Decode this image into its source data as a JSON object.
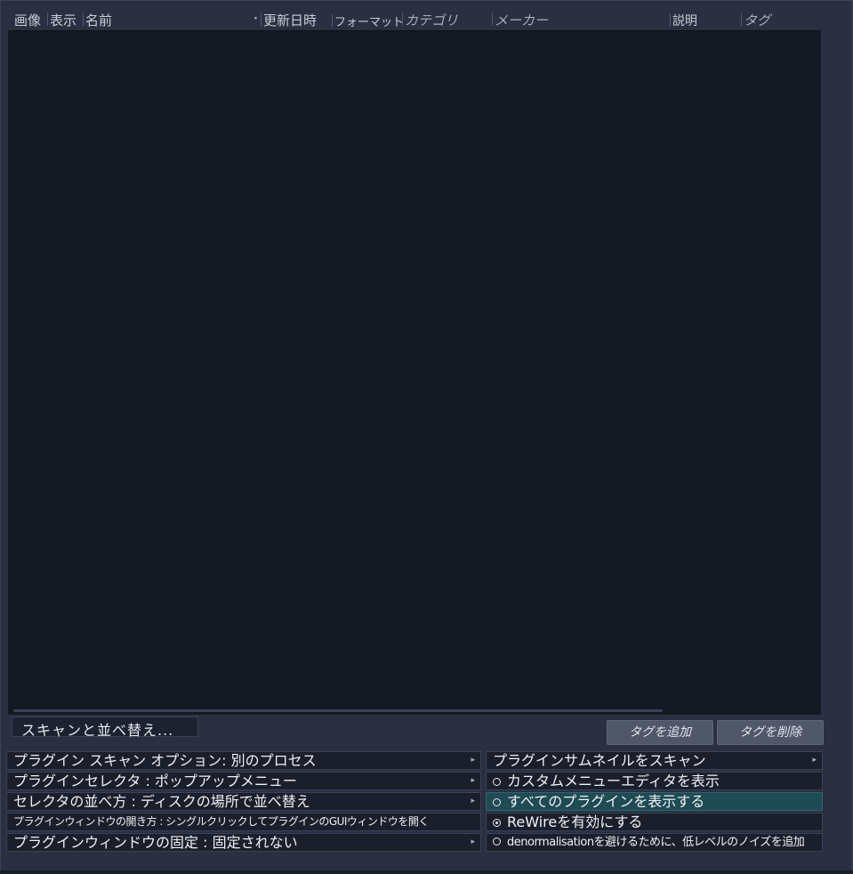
{
  "columns": [
    {
      "key": "image",
      "label": "画像"
    },
    {
      "key": "display",
      "label": "表示"
    },
    {
      "key": "name",
      "label": "名前"
    },
    {
      "key": "updated",
      "label": "更新日時"
    },
    {
      "key": "format",
      "label": "フォーマット"
    },
    {
      "key": "category",
      "label": "カテゴリ"
    },
    {
      "key": "maker",
      "label": "メーカー"
    },
    {
      "key": "description",
      "label": "説明"
    },
    {
      "key": "tag",
      "label": "タグ"
    }
  ],
  "sort_indicator": "・",
  "scan_button": "スキャンと並べ替え...",
  "tag_buttons": {
    "add": "タグを追加",
    "remove": "タグを削除"
  },
  "left_options": [
    {
      "label": "プラグイン スキャン オプション: 別のプロセス",
      "submenu": true
    },
    {
      "label": "プラグインセレクタ : ポップアップメニュー",
      "submenu": true
    },
    {
      "label": "セレクタの並べ方 : ディスクの場所で並べ替え",
      "submenu": true
    },
    {
      "label": "プラグインウィンドウの開き方 : シングルクリックしてプラグインのGUIウィンドウを開く",
      "submenu": false
    },
    {
      "label": "プラグインウィンドウの固定 : 固定されない",
      "submenu": true
    }
  ],
  "right_options": [
    {
      "label": "プラグインサムネイルをスキャン",
      "type": "submenu"
    },
    {
      "label": "カスタムメニューエディタを表示",
      "type": "radio",
      "checked": false
    },
    {
      "label": "すべてのプラグインを表示する",
      "type": "radio",
      "checked": false,
      "highlighted": true
    },
    {
      "label": "ReWireを有効にする",
      "type": "radio",
      "checked": true
    },
    {
      "label": "denormalisationを避けるために、低レベルのノイズを追加",
      "type": "radio",
      "checked": false
    }
  ],
  "submenu_arrow": "▸"
}
